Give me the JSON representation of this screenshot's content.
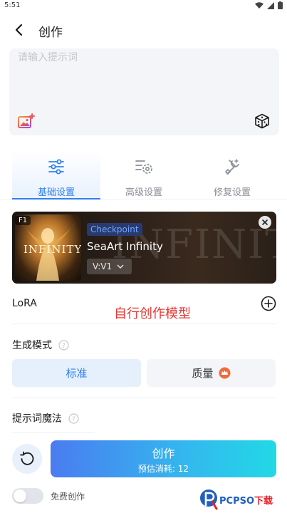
{
  "status_bar": {
    "time": "5:51"
  },
  "header": {
    "back_icon": "back-arrow-icon",
    "title": "创作"
  },
  "prompt": {
    "placeholder": "请输入提示词",
    "value": "",
    "image_icon": "image-add-icon",
    "random_icon": "dice-icon"
  },
  "tabs": [
    {
      "label": "基础设置",
      "icon": "sliders-icon",
      "active": true
    },
    {
      "label": "高级设置",
      "icon": "gear-list-icon",
      "active": false
    },
    {
      "label": "修复设置",
      "icon": "repair-tools-icon",
      "active": false
    }
  ],
  "model": {
    "badge": "F1",
    "type_tag": "Checkpoint",
    "name": "SeaArt Infinity",
    "version": "V:V1",
    "thumbnail_text": "INFINITY",
    "background_text": "INFINITY"
  },
  "lora": {
    "label": "LoRA",
    "annotation": "自行创作模型",
    "add_icon": "plus-circle-icon"
  },
  "generation_mode": {
    "title": "生成模式",
    "options": [
      {
        "label": "标准",
        "selected": true
      },
      {
        "label": "质量",
        "selected": false,
        "icon": "crown-icon"
      }
    ]
  },
  "prompt_magic": {
    "title": "提示词魔法"
  },
  "actions": {
    "reset_icon": "reset-icon",
    "create_label": "创作",
    "create_cost": "预估消耗: 12",
    "free_label": "免费创作",
    "free_enabled": false
  },
  "watermark": {
    "text_prefix": "PCPSO",
    "text_suffix": "下载"
  },
  "colors": {
    "accent": "#2f80ed",
    "annotation_red": "#e53935",
    "quality_crown": "#f06a3c"
  }
}
